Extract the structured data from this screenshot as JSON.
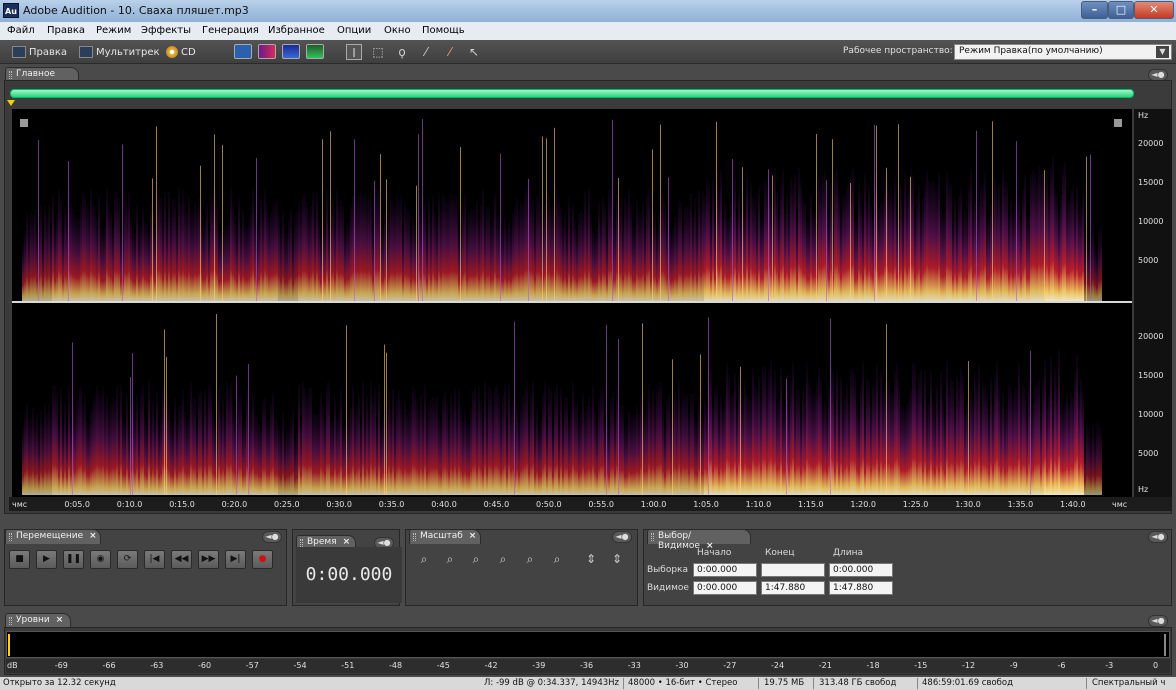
{
  "window": {
    "logo": "Au",
    "title": "Adobe Audition - 10. Сваха пляшет.mp3",
    "controls": [
      "minimize-icon",
      "maximize-icon",
      "close-icon"
    ]
  },
  "menu": [
    "Файл",
    "Правка",
    "Режим",
    "Эффекты",
    "Генерация",
    "Избранное",
    "Опции",
    "Окно",
    "Помощь"
  ],
  "toolbar": {
    "edit_label": "Правка",
    "multitrack_label": "Мультитрек",
    "cd_label": "CD",
    "workspace_label": "Рабочее пространство:",
    "workspace_value": "Режим Правка(по умолчанию)"
  },
  "main_panel": {
    "tab": "Главное",
    "hz_unit": "Hz",
    "hz_ticks_top": [
      "20000",
      "15000",
      "10000",
      "5000"
    ],
    "hz_ticks_bottom": [
      "20000",
      "15000",
      "10000",
      "5000",
      "Hz"
    ],
    "time_labels": [
      "чмс",
      "0:05.0",
      "0:10.0",
      "0:15.0",
      "0:20.0",
      "0:25.0",
      "0:30.0",
      "0:35.0",
      "0:40.0",
      "0:45.0",
      "0:50.0",
      "0:55.0",
      "1:00.0",
      "1:05.0",
      "1:10.0",
      "1:15.0",
      "1:20.0",
      "1:25.0",
      "1:30.0",
      "1:35.0",
      "1:40.0",
      "чмс"
    ],
    "colors": {
      "background": "#000000",
      "low": "#2a0a40",
      "mid": "#c41f2e",
      "high": "#ffd166",
      "peak": "#fff7d0"
    }
  },
  "transport": {
    "tab": "Перемещение",
    "buttons": [
      "stop-icon",
      "play-icon",
      "pause-icon",
      "play-from-cursor-icon",
      "loop-icon",
      "go-to-start-icon",
      "rewind-icon",
      "fast-forward-icon",
      "go-to-end-icon",
      "record-icon"
    ]
  },
  "time": {
    "tab": "Время",
    "value": "0:00.000"
  },
  "zoom": {
    "tab": "Масштаб"
  },
  "selection": {
    "tab": "Выбор/Видимое",
    "headers": [
      "Начало",
      "Конец",
      "Длина"
    ],
    "rows": [
      {
        "label": "Выборка",
        "start": "0:00.000",
        "end": "",
        "length": "0:00.000"
      },
      {
        "label": "Видимое",
        "start": "0:00.000",
        "end": "1:47.880",
        "length": "1:47.880"
      }
    ]
  },
  "levels": {
    "tab": "Уровни",
    "scale": [
      "dB",
      "-69",
      "-66",
      "-63",
      "-60",
      "-57",
      "-54",
      "-51",
      "-48",
      "-45",
      "-42",
      "-39",
      "-36",
      "-33",
      "-30",
      "-27",
      "-24",
      "-21",
      "-18",
      "-15",
      "-12",
      "-9",
      "-6",
      "-3",
      "0"
    ]
  },
  "status": {
    "opened": "Открыто за 12.32 секунд",
    "cursor": "Л: -99 dB @  0:34.337, 14943Hz",
    "format": "48000 • 16-бит • Стерео",
    "size": "19.75 МБ",
    "free": "313.48 ГБ свобод",
    "free_time": "486:59:01.69 свобод",
    "view": "Спектральный ч"
  }
}
